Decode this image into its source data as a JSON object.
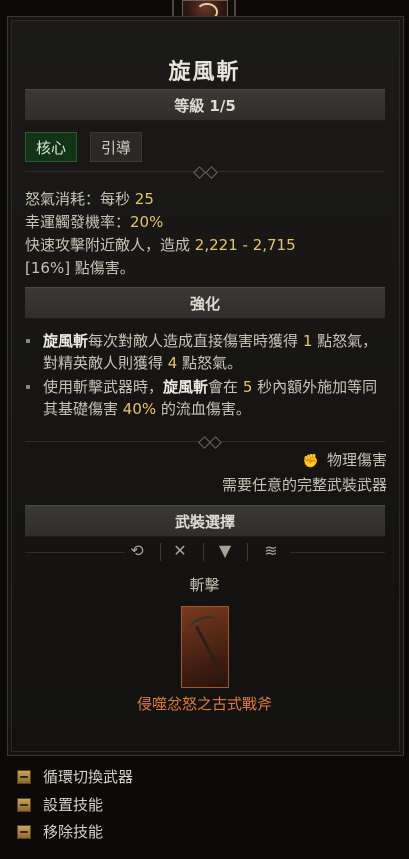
{
  "skill": {
    "name": "旋風斬",
    "rank_label": "等級 1/5",
    "tags": [
      "核心",
      "引導"
    ]
  },
  "stats": {
    "fury_cost_label": "怒氣消耗：每秒",
    "fury_cost_value": "25",
    "lucky_hit_label": "幸運觸發機率：",
    "lucky_hit_value": "20%",
    "desc_a": "快速攻擊附近敵人，造成",
    "damage_range": "2,221 - 2,715",
    "desc_b": "[16%] 點傷害。"
  },
  "enhancement": {
    "header": "強化",
    "bullet1": {
      "skill": "旋風斬",
      "t1": "每次對敵人造成直接傷害時獲得",
      "v1": "1",
      "t2": "點怒氣，對精英敵人則獲得",
      "v2": "4",
      "t3": "點怒氣。"
    },
    "bullet2": {
      "t1": "使用斬擊武器時，",
      "skill": "旋風斬",
      "t2": "會在",
      "v1": "5",
      "t3": "秒內額外施加等同其基礎傷害",
      "v2": "40%",
      "t4": "的流血傷害。"
    }
  },
  "damage_type": "物理傷害",
  "requirement": "需要任意的完整武裝武器",
  "weapon_section": {
    "header": "武裝選擇",
    "icons": [
      "cycle-icon",
      "crossed-swords-icon",
      "funnel-icon",
      "wifi-signal-icon"
    ],
    "category": "斬擊",
    "weapon_name": "侵噬忿怒之古式戰斧"
  },
  "actions": [
    "循環切換武器",
    "設置技能",
    "移除技能"
  ],
  "colors": {
    "highlight": "#e8c36a",
    "legendary_orange": "#e07a42",
    "core_tag": "#123316"
  }
}
